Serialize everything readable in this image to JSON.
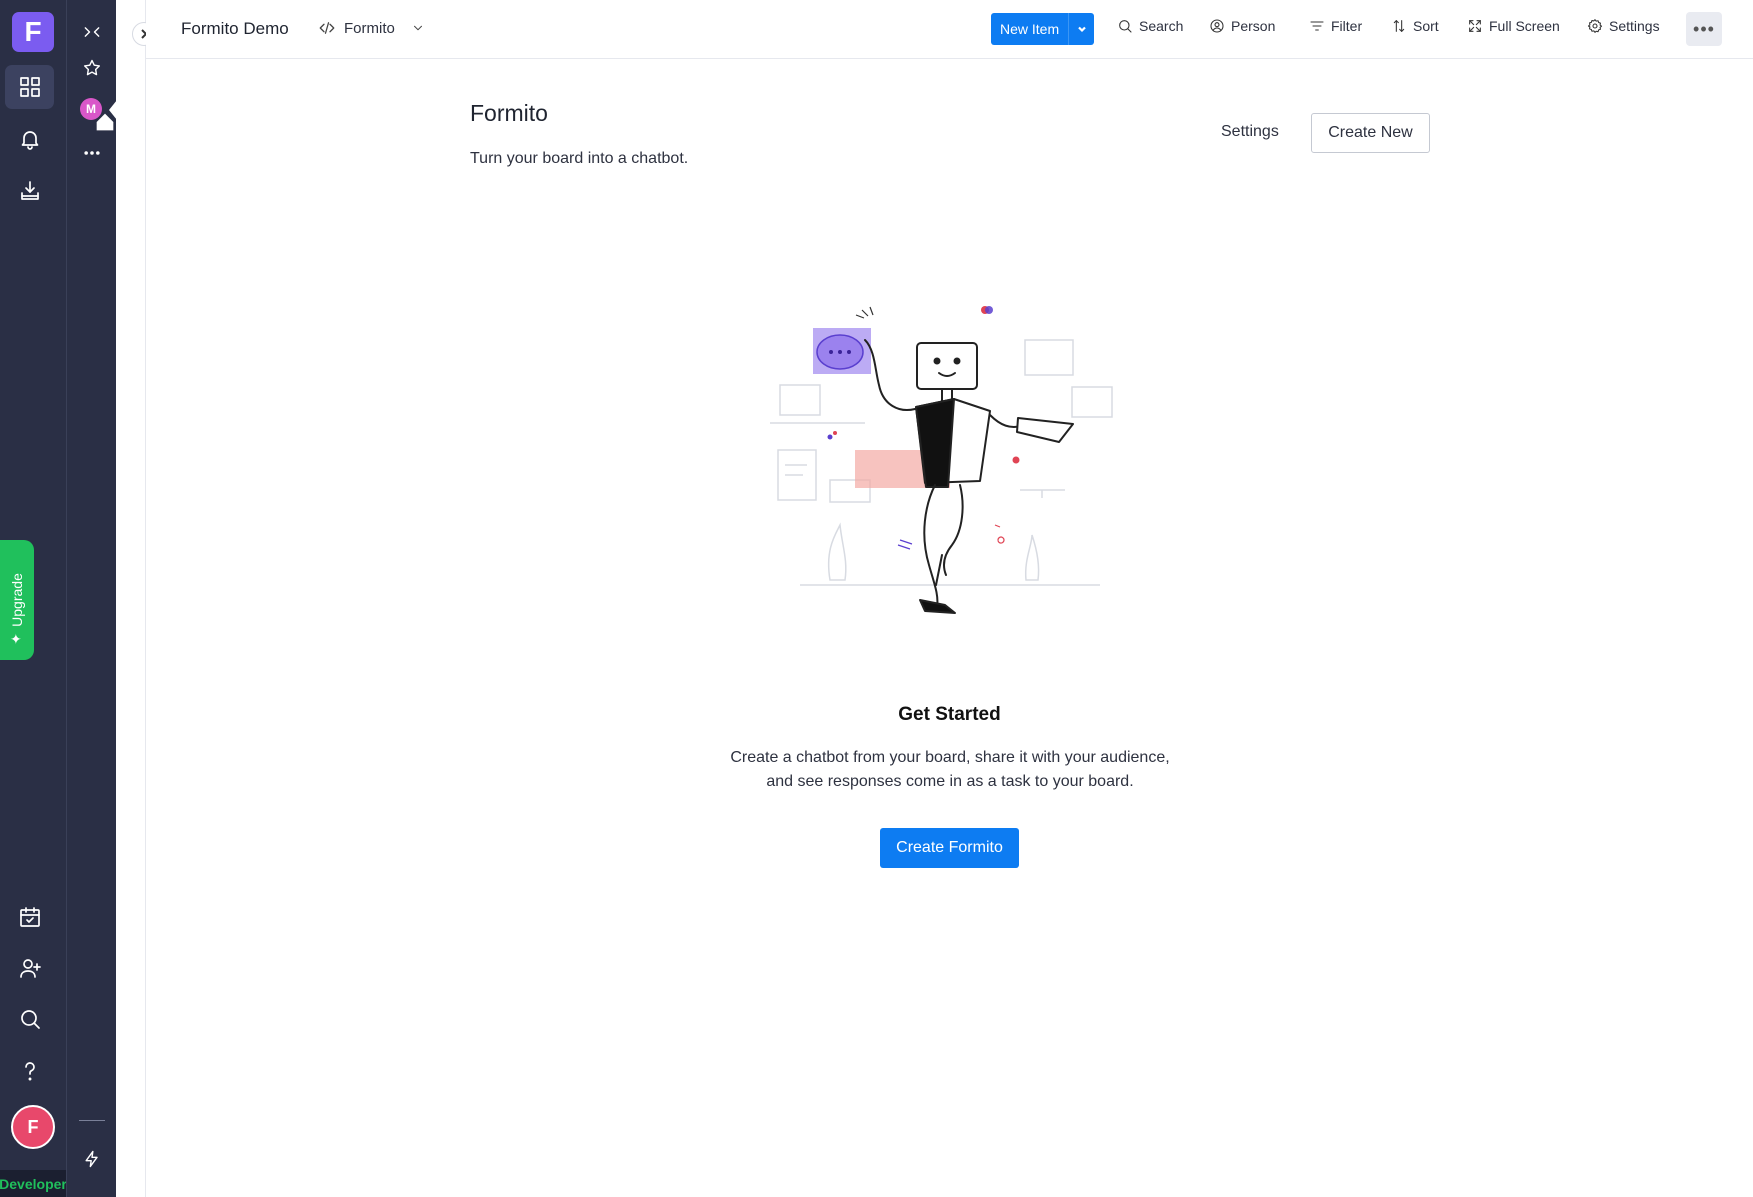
{
  "rail": {
    "logo_letter": "F",
    "upgrade_label": "Upgrade",
    "user_initial": "F",
    "developer_label": "Developer"
  },
  "rail2": {
    "workspace_initial": "M"
  },
  "header": {
    "board_title": "Formito Demo",
    "view_name": "Formito",
    "new_item_label": "New Item",
    "search_label": "Search",
    "person_label": "Person",
    "filter_label": "Filter",
    "sort_label": "Sort",
    "fullscreen_label": "Full Screen",
    "settings_label": "Settings"
  },
  "main": {
    "title": "Formito",
    "subtitle": "Turn your board into a chatbot.",
    "settings_link": "Settings",
    "create_new_label": "Create New",
    "get_started": "Get Started",
    "description_line1": "Create a chatbot from your board, share it with your audience,",
    "description_line2": "and see responses come in as a task to your board.",
    "create_formito_label": "Create Formito"
  },
  "colors": {
    "rail_bg": "#2a2f45",
    "accent_blue": "#0d7cf2",
    "logo_purple": "#7b5cf0",
    "upgrade_green": "#20c05c",
    "avatar_pink": "#e8486b"
  }
}
